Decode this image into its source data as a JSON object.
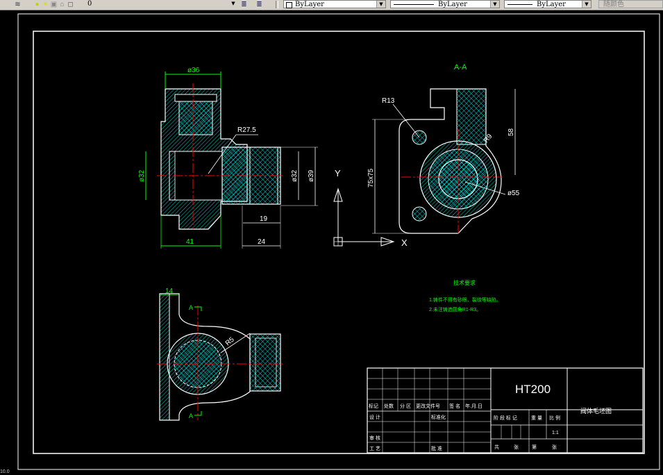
{
  "toolbar": {
    "layer_value": "0",
    "color_value": "ByLayer",
    "linetype_value": "ByLayer",
    "lineweight_value": "ByLayer",
    "plotstyle_value": "随颜色"
  },
  "drawing": {
    "view_title": "A-A",
    "dimensions": {
      "dia36": "ø36",
      "dia32_left": "ø32",
      "r27_5": "R27.5",
      "dia32_right": "ø32",
      "dia39": "ø39",
      "len19": "19",
      "len41": "41",
      "len24": "24",
      "r13": "R13",
      "size75x75": "75x75",
      "len58": "58",
      "r9": "R9",
      "dia55": "ø55",
      "len14": "14",
      "r5": "R5",
      "sect_a_top": "A",
      "sect_a_bottom": "A"
    },
    "ucs": {
      "x_label": "X",
      "y_label": "Y"
    },
    "notes": {
      "title": "技术要求",
      "line1": "1.铸件不得有砂眼、裂纹等缺陷。",
      "line2": "2.未注铸造圆角R1-R3。"
    },
    "title_block": {
      "material": "HT200",
      "part_name": "阀体毛坯图",
      "row_marks": "标记",
      "row_count": "处数",
      "row_area": "分 区",
      "row_docno": "更改文件号",
      "row_sign": "签 名",
      "row_date": "年.月.日",
      "designer": "设 计",
      "standard": "标准化",
      "review": "审 核",
      "process": "工 艺",
      "approve": "批 准",
      "stage": "阶 段 标 记",
      "weight": "重 量",
      "scale": "比 例",
      "scale_value": "1:1",
      "sheet_total": "共",
      "sheet": "张",
      "sheet_no": "第"
    }
  },
  "status": {
    "coords": "10.0"
  },
  "colors": {
    "background": "#000000",
    "geometry": "#ffffff",
    "dimension": "#00ff00",
    "hatch": "#00ffff",
    "center": "#ff0000",
    "body": "#00ffff"
  }
}
